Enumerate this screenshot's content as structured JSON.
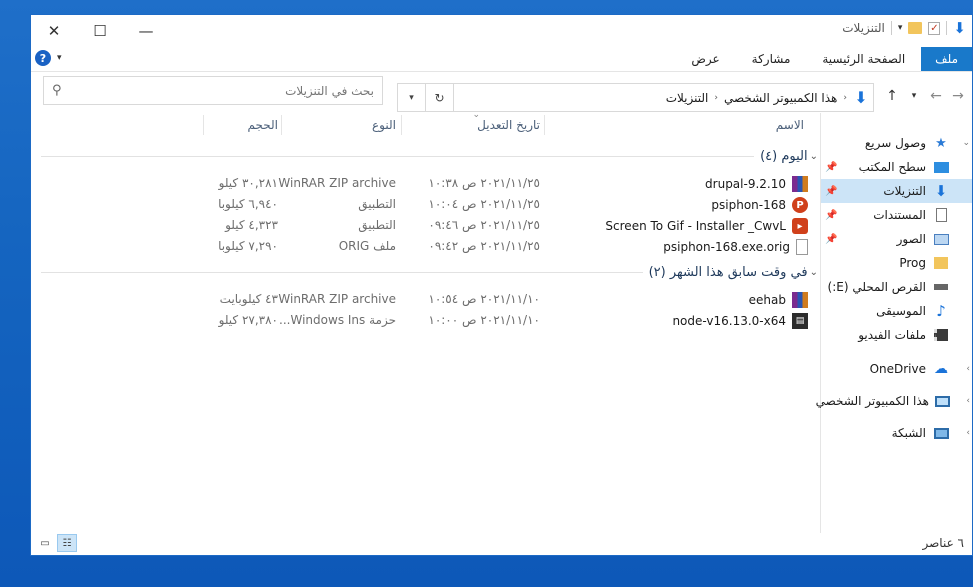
{
  "window": {
    "title": "التنزيلات",
    "minimize": "—",
    "maximize": "☐",
    "close": "✕"
  },
  "ribbon": {
    "tabs": [
      {
        "label": "ملف"
      },
      {
        "label": "الصفحة الرئيسية"
      },
      {
        "label": "مشاركة"
      },
      {
        "label": "عرض"
      }
    ],
    "help": "?"
  },
  "address": {
    "crumbs": [
      "هذا الكمبيوتر الشخصي",
      "التنزيلات"
    ]
  },
  "search": {
    "placeholder": "بحث في التنزيلات"
  },
  "columns": {
    "name": "الاسم",
    "date": "تاريخ التعديل",
    "type": "النوع",
    "size": "الحجم"
  },
  "groups": [
    {
      "title": "اليوم (٤)",
      "files": [
        {
          "name": "drupal-9.2.10",
          "date": "٢٠٢١/١١/٢٥ ص ١٠:٣٨",
          "type": "WinRAR ZIP archive",
          "size": "٣٠,٢٨١ كيلو",
          "icon": "winrar-icon"
        },
        {
          "name": "psiphon-168",
          "date": "٢٠٢١/١١/٢٥ ص ١٠:٠٤",
          "type": "التطبيق",
          "size": "٦,٩٤٠ كيلوبا",
          "icon": "psiphon-icon"
        },
        {
          "name": "Screen To Gif - Installer _CwvL",
          "date": "٢٠٢١/١١/٢٥ ص ٠٩:٤٦",
          "type": "التطبيق",
          "size": "٤,٣٢٣ كيلو",
          "icon": "screentogif-icon"
        },
        {
          "name": "psiphon-168.exe.orig",
          "date": "٢٠٢١/١١/٢٥ ص ٠٩:٤٢",
          "type": "ملف ORIG",
          "size": "٧,٢٩٠ كيلوبا",
          "icon": "file-icon"
        }
      ]
    },
    {
      "title": "في وقت سابق هذا الشهر (٢)",
      "files": [
        {
          "name": "eehab",
          "date": "٢٠٢١/١١/١٠ ص ١٠:٥٤",
          "type": "WinRAR ZIP archive",
          "size": "٤٣ كيلوبايت",
          "icon": "winrar-icon"
        },
        {
          "name": "node-v16.13.0-x64",
          "date": "٢٠٢١/١١/١٠ ص ١٠:٠٠",
          "type": "حزمة Windows Ins...",
          "size": "٢٧,٣٨٠ كيلو",
          "icon": "msi-icon"
        }
      ]
    }
  ],
  "sidebar": {
    "items": [
      {
        "label": "وصول سريع",
        "icon": "star-icon"
      },
      {
        "label": "سطح المكتب",
        "icon": "desktop-icon"
      },
      {
        "label": "التنزيلات",
        "icon": "download-icon"
      },
      {
        "label": "المستندات",
        "icon": "documents-icon"
      },
      {
        "label": "الصور",
        "icon": "pictures-icon"
      },
      {
        "label": "Prog",
        "icon": "folder-icon"
      },
      {
        "label": "القرص المحلي (E:)",
        "icon": "drive-icon"
      },
      {
        "label": "الموسيقى",
        "icon": "music-icon"
      },
      {
        "label": "ملفات الفيديو",
        "icon": "video-icon"
      },
      {
        "label": "OneDrive",
        "icon": "cloud-icon"
      },
      {
        "label": "هذا الكمبيوتر الشخصي",
        "icon": "computer-icon"
      },
      {
        "label": "الشبكة",
        "icon": "network-icon"
      }
    ]
  },
  "status": {
    "count": "٦ عناصر"
  },
  "colors": {
    "accent": "#1979ca",
    "selection": "#cce4f7",
    "group_title": "#1e395b"
  }
}
